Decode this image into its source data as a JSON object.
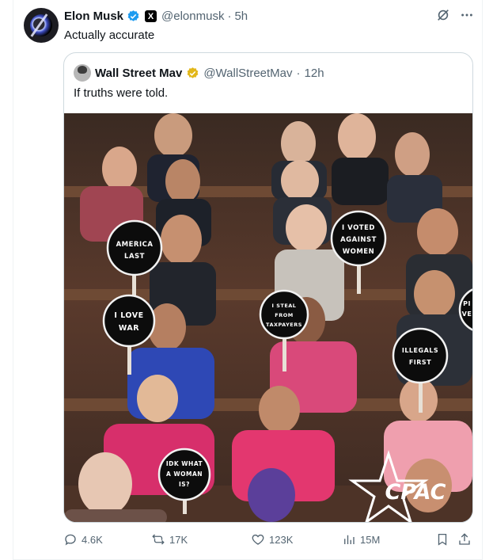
{
  "tweet": {
    "author_name": "Elon Musk",
    "handle": "@elonmusk",
    "separator": "·",
    "time": "5h",
    "x_badge": "X",
    "text": "Actually accurate"
  },
  "quote": {
    "author_name": "Wall Street Mav",
    "handle": "@WallStreetMav",
    "separator": "·",
    "time": "12h",
    "text": "If truths were told.",
    "image": {
      "signs": [
        {
          "lines": [
            "AMERICA",
            "LAST"
          ]
        },
        {
          "lines": [
            "I VOTED",
            "AGAINST",
            "WOMEN"
          ]
        },
        {
          "lines": [
            "I LOVE",
            "WAR"
          ]
        },
        {
          "lines": [
            "I STEAL",
            "FROM",
            "TAXPAYERS"
          ]
        },
        {
          "lines": [
            "ILLEGALS",
            "FIRST"
          ]
        },
        {
          "lines": [
            "IDK WHAT",
            "A WOMAN",
            "IS?"
          ]
        }
      ],
      "edge_sign_text": [
        "PI",
        "VE"
      ],
      "watermark": "CPAC"
    }
  },
  "actions": {
    "replies": "4.6K",
    "reposts": "17K",
    "likes": "123K",
    "views": "15M"
  },
  "colors": {
    "verified_blue": "#1d9bf0",
    "verified_gold": "#e2b719",
    "muted_text": "#536471"
  }
}
